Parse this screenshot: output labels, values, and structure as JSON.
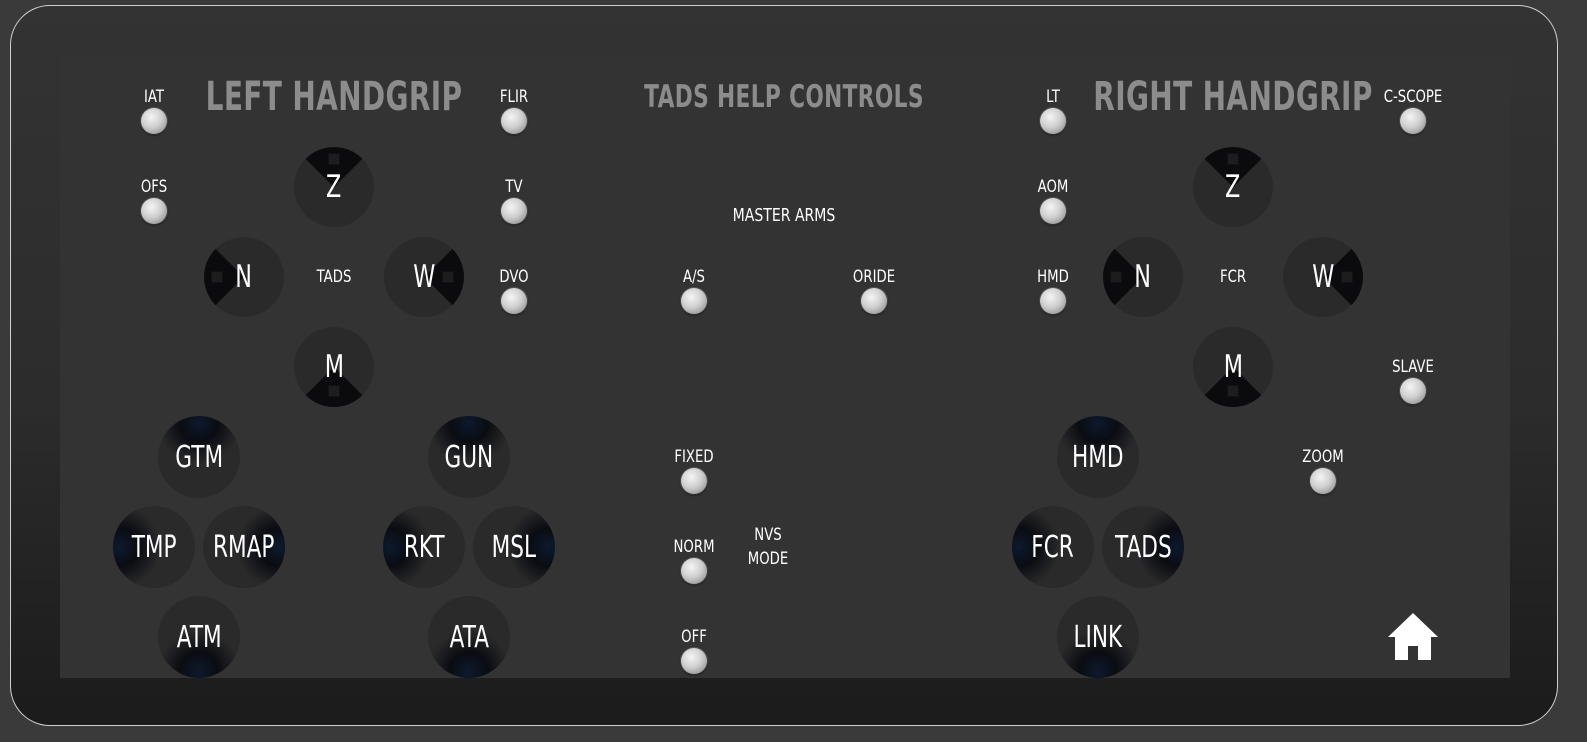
{
  "titles": {
    "left": "LEFT HANDGRIP",
    "center": "TADS HELP CONTROLS",
    "right": "RIGHT HANDGRIP"
  },
  "left": {
    "iat": "IAT",
    "ofs": "OFS",
    "flir": "FLIR",
    "tv": "TV",
    "dvo": "DVO",
    "tads": "TADS",
    "hat": {
      "up": "Z",
      "left": "N",
      "right": "W",
      "down": "M"
    },
    "sel1": {
      "up": "GTM",
      "left": "TMP",
      "right": "RMAP",
      "down": "ATM"
    },
    "sel2": {
      "up": "GUN",
      "left": "RKT",
      "right": "MSL",
      "down": "ATA"
    }
  },
  "center": {
    "master_arms": "MASTER ARMS",
    "as": "A/S",
    "oride": "ORIDE",
    "fixed": "FIXED",
    "norm": "NORM",
    "off": "OFF",
    "nvs_mode_1": "NVS",
    "nvs_mode_2": "MODE"
  },
  "right": {
    "lt": "LT",
    "aom": "AOM",
    "hmd": "HMD",
    "cscope": "C-SCOPE",
    "slave": "SLAVE",
    "zoom": "ZOOM",
    "fcr": "FCR",
    "hat": {
      "up": "Z",
      "left": "N",
      "right": "W",
      "down": "M"
    },
    "sel": {
      "up": "HMD",
      "left": "FCR",
      "right": "TADS",
      "down": "LINK"
    }
  },
  "icons": {
    "home": "home-icon"
  },
  "colors": {
    "background": "#333333",
    "title": "#8c8c8c",
    "label": "#ffffff",
    "accent_shadow": "#0a0f18"
  }
}
